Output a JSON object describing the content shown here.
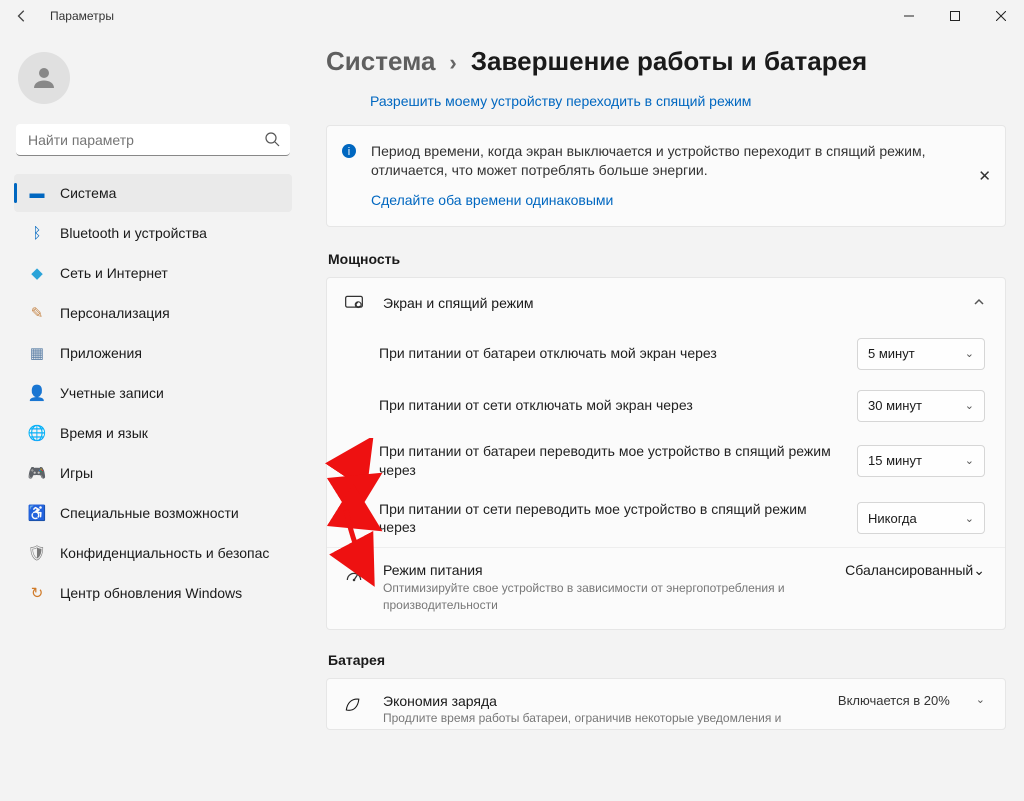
{
  "titlebar": {
    "title": "Параметры"
  },
  "search": {
    "placeholder": "Найти параметр"
  },
  "nav": {
    "items": [
      {
        "label": "Система"
      },
      {
        "label": "Bluetooth и устройства"
      },
      {
        "label": "Сеть и Интернет"
      },
      {
        "label": "Персонализация"
      },
      {
        "label": "Приложения"
      },
      {
        "label": "Учетные записи"
      },
      {
        "label": "Время и язык"
      },
      {
        "label": "Игры"
      },
      {
        "label": "Специальные возможности"
      },
      {
        "label": "Конфиденциальность и безопас"
      },
      {
        "label": "Центр обновления Windows"
      }
    ]
  },
  "crumb": {
    "parent": "Система",
    "current": "Завершение работы и батарея"
  },
  "toplink": "Разрешить моему устройству переходить в спящий режим",
  "info": {
    "text": "Период времени, когда экран выключается и устройство переходит в спящий режим, отличается, что может потреблять больше энергии.",
    "link": "Сделайте оба времени одинаковыми"
  },
  "power": {
    "header": "Мощность",
    "screen_card": "Экран и спящий режим",
    "rows": [
      {
        "label": "При питании от батареи отключать мой экран через",
        "value": "5 минут"
      },
      {
        "label": "При питании от сети отключать мой экран через",
        "value": "30 минут"
      },
      {
        "label": "При питании от батареи переводить мое устройство в спящий режим через",
        "value": "15 минут"
      },
      {
        "label": "При питании от сети переводить мое устройство в спящий режим через",
        "value": "Никогда"
      }
    ],
    "mode": {
      "title": "Режим питания",
      "sub": "Оптимизируйте свое устройство в зависимости от энергопотребления и производительности",
      "value": "Сбалансированный"
    }
  },
  "battery": {
    "header": "Батарея",
    "saver": {
      "title": "Экономия заряда",
      "sub": "Продлите время работы батареи, ограничив некоторые уведомления и",
      "status": "Включается в 20%"
    }
  }
}
